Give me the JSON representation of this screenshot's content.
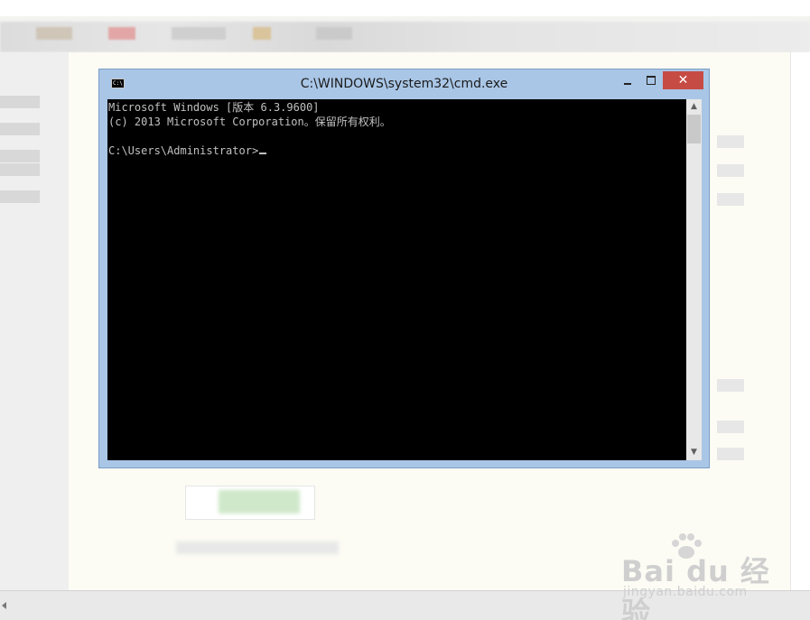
{
  "window": {
    "title": "C:\\WINDOWS\\system32\\cmd.exe",
    "icon_label": "C:\\",
    "controls": {
      "minimize_icon": "minimize-icon",
      "maximize_icon": "maximize-icon",
      "close_label": "✕"
    }
  },
  "console": {
    "lines": [
      "Microsoft Windows [版本 6.3.9600]",
      "(c) 2013 Microsoft Corporation。保留所有权利。",
      "",
      "C:\\Users\\Administrator>"
    ],
    "background_color": "#000000",
    "text_color": "#c0c0c0"
  },
  "scrollbar": {
    "up_arrow": "▲",
    "down_arrow": "▼"
  },
  "watermark": {
    "logo_text": "Bai du 经验",
    "url": "jingyan.baidu.com"
  },
  "colors": {
    "window_frame": "#a9c6e6",
    "close_button": "#c74b45"
  }
}
